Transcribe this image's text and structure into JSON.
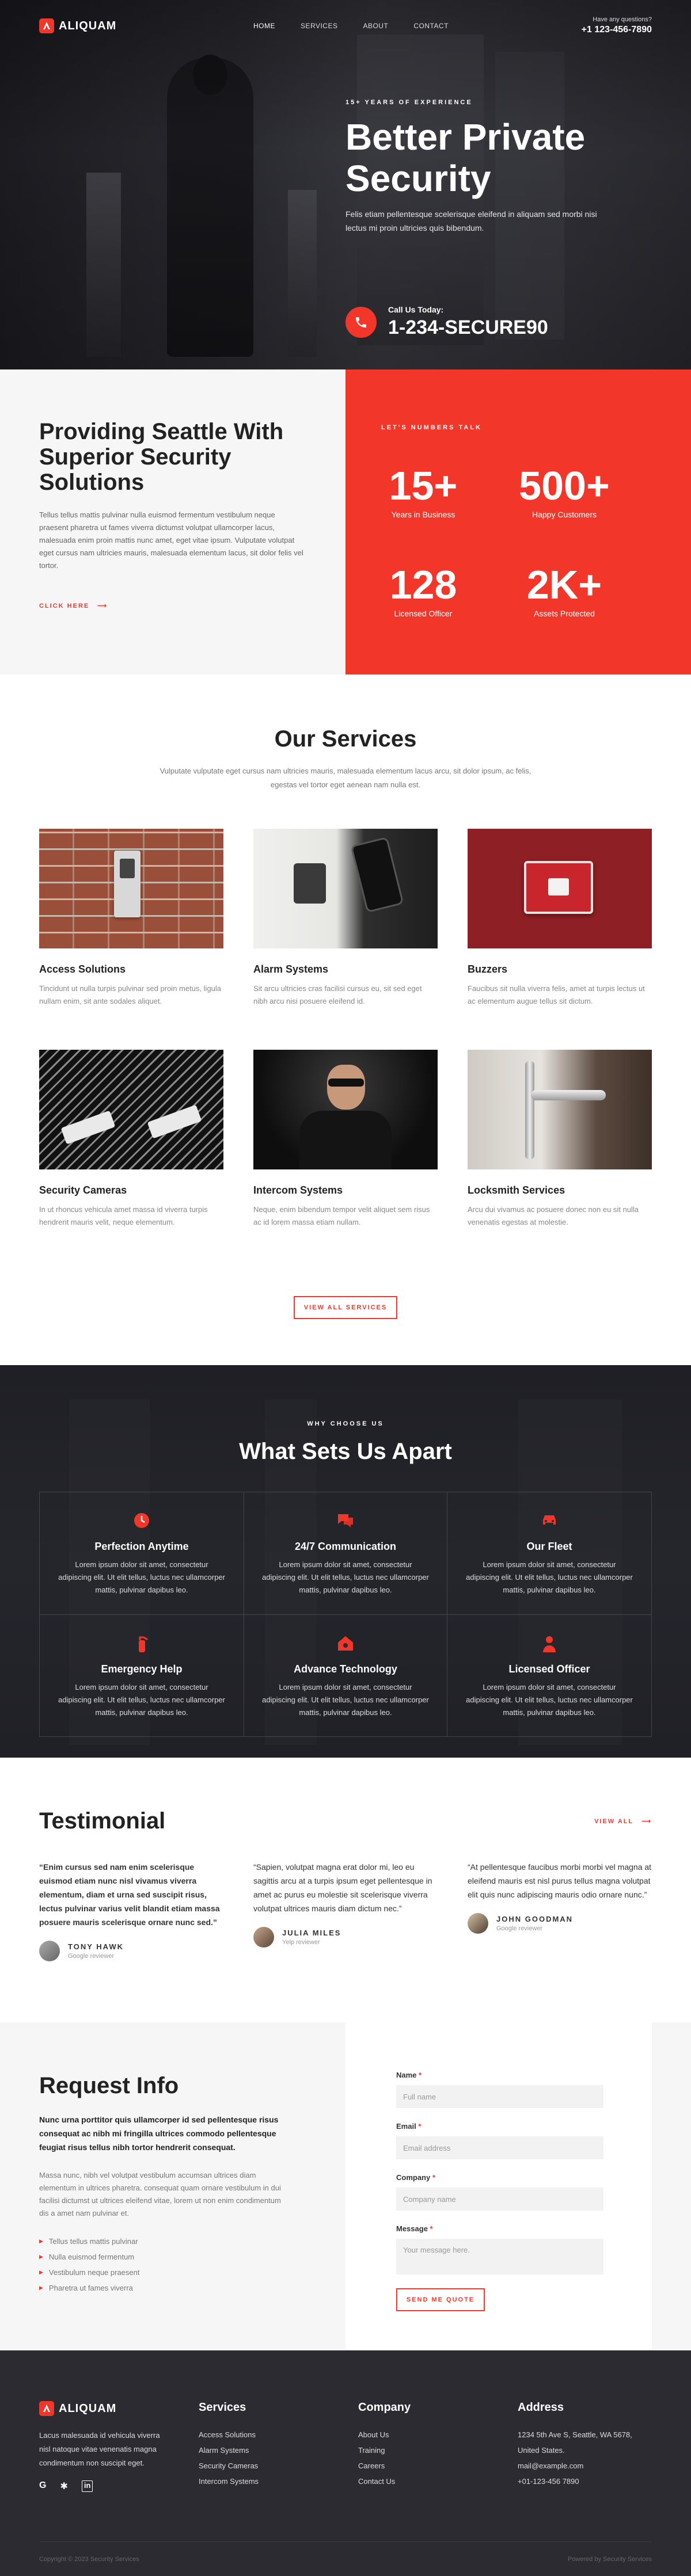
{
  "brand": {
    "name": "ALIQUAM",
    "accent": "#f2372a"
  },
  "nav": {
    "items": [
      "HOME",
      "SERVICES",
      "ABOUT",
      "CONTACT"
    ]
  },
  "top_contact": {
    "question": "Have any questions?",
    "phone": "+1 123-456-7890"
  },
  "hero": {
    "eyebrow": "15+ YEARS OF EXPERIENCE",
    "title_line1": "Better Private",
    "title_line2": "Security",
    "subtitle": "Felis etiam pellentesque scelerisque eleifend in aliquam sed morbi nisi lectus mi proin ultricies quis bibendum.",
    "call_label": "Call Us Today:",
    "call_number": "1-234-SECURE90"
  },
  "about": {
    "title": "Providing Seattle With Superior Security Solutions",
    "text": "Tellus tellus mattis pulvinar nulla euismod fermentum vestibulum neque praesent pharetra ut fames viverra dictumst volutpat ullamcorper lacus, malesuada enim proin mattis nunc amet, eget vitae ipsum. Vulputate volutpat eget cursus nam ultricies mauris, malesuada elementum lacus, sit dolor felis vel tortor.",
    "link": "CLICK HERE"
  },
  "stats": {
    "eyebrow": "LET'S NUMBERS TALK",
    "items": [
      {
        "num": "15+",
        "label": "Years in Business"
      },
      {
        "num": "500+",
        "label": "Happy Customers"
      },
      {
        "num": "128",
        "label": "Licensed Officer"
      },
      {
        "num": "2K+",
        "label": "Assets Protected"
      }
    ]
  },
  "services": {
    "title": "Our Services",
    "subtitle": "Vulputate vulputate eget cursus nam ultricies mauris, malesuada elementum lacus arcu, sit dolor ipsum, ac felis, egestas vel tortor eget aenean nam nulla est.",
    "items": [
      {
        "name": "Access Solutions",
        "desc": "Tincidunt ut nulla turpis pulvinar sed proin metus, ligula nullam enim, sit ante sodales aliquet."
      },
      {
        "name": "Alarm Systems",
        "desc": "Sit arcu ultricies cras facilisi cursus eu, sit sed eget nibh arcu nisi posuere eleifend id."
      },
      {
        "name": "Buzzers",
        "desc": "Faucibus sit nulla viverra felis, amet at turpis lectus ut ac elementum augue tellus sit dictum."
      },
      {
        "name": "Security Cameras",
        "desc": "In ut rhoncus vehicula amet massa id viverra turpis hendrerit mauris velit, neque elementum."
      },
      {
        "name": "Intercom Systems",
        "desc": "Neque, enim bibendum tempor velit aliquet sem risus ac id lorem massa etiam nullam."
      },
      {
        "name": "Locksmith Services",
        "desc": "Arcu dui vivamus ac posuere donec non eu sit nulla venenatis egestas at molestie."
      }
    ],
    "button": "VIEW ALL SERVICES"
  },
  "why": {
    "eyebrow": "WHY CHOOSE US",
    "title": "What Sets Us Apart",
    "items": [
      {
        "icon": "clock-icon",
        "title": "Perfection Anytime",
        "desc": "Lorem ipsum dolor sit amet, consectetur adipiscing elit. Ut elit tellus, luctus nec ullamcorper mattis, pulvinar dapibus leo."
      },
      {
        "icon": "chat-icon",
        "title": "24/7 Communication",
        "desc": "Lorem ipsum dolor sit amet, consectetur adipiscing elit. Ut elit tellus, luctus nec ullamcorper mattis, pulvinar dapibus leo."
      },
      {
        "icon": "car-icon",
        "title": "Our Fleet",
        "desc": "Lorem ipsum dolor sit amet, consectetur adipiscing elit. Ut elit tellus, luctus nec ullamcorper mattis, pulvinar dapibus leo."
      },
      {
        "icon": "fire-extinguisher-icon",
        "title": "Emergency Help",
        "desc": "Lorem ipsum dolor sit amet, consectetur adipiscing elit. Ut elit tellus, luctus nec ullamcorper mattis, pulvinar dapibus leo."
      },
      {
        "icon": "house-gear-icon",
        "title": "Advance Technology",
        "desc": "Lorem ipsum dolor sit amet, consectetur adipiscing elit. Ut elit tellus, luctus nec ullamcorper mattis, pulvinar dapibus leo."
      },
      {
        "icon": "officer-icon",
        "title": "Licensed Officer",
        "desc": "Lorem ipsum dolor sit amet, consectetur adipiscing elit. Ut elit tellus, luctus nec ullamcorper mattis, pulvinar dapibus leo."
      }
    ]
  },
  "testimonials": {
    "title": "Testimonial",
    "view_all": "VIEW ALL",
    "items": [
      {
        "quote": "“Enim cursus sed nam enim scelerisque euismod etiam nunc nisl vivamus viverra elementum, diam et urna sed suscipit risus, lectus pulvinar varius velit blandit etiam massa posuere mauris scelerisque ornare nunc sed.”",
        "name": "TONY HAWK",
        "role": "Google reviewer"
      },
      {
        "quote": "“Sapien, volutpat magna erat dolor mi, leo eu sagittis arcu at a turpis ipsum eget pellentesque in amet ac purus eu molestie sit scelerisque viverra volutpat ultrices mauris diam dictum nec.”",
        "name": "JULIA MILES",
        "role": "Yelp reviewer"
      },
      {
        "quote": "“At pellentesque faucibus morbi morbi vel magna at eleifend mauris est nisl purus tellus magna volutpat elit quis nunc adipiscing mauris odio ornare nunc.”",
        "name": "JOHN GOODMAN",
        "role": "Google reviewer"
      }
    ]
  },
  "request": {
    "title": "Request Info",
    "lead": "Nunc urna porttitor quis ullamcorper id sed pellentesque risus consequat ac nibh mi fringilla ultrices commodo pellentesque feugiat risus tellus nibh tortor hendrerit consequat.",
    "text": "Massa nunc, nibh vel volutpat vestibulum accumsan ultrices diam elementum in ultrices pharetra. consequat quam ornare vestibulum in dui facilisi dictumst ut ultrices eleifend vitae, lorem ut non enim condimentum dis a amet nam pulvinar et.",
    "bullets": [
      "Tellus tellus mattis pulvinar",
      "Nulla euismod fermentum",
      "Vestibulum neque praesent",
      "Pharetra ut fames viverra"
    ]
  },
  "form": {
    "name_label": "Name",
    "name_placeholder": "Full name",
    "email_label": "Email",
    "email_placeholder": "Email address",
    "company_label": "Company",
    "company_placeholder": "Company name",
    "message_label": "Message",
    "message_placeholder": "Your message here.",
    "submit": "SEND ME QUOTE"
  },
  "footer": {
    "about": "Lacus malesuada id vehicula viverra nisl natoque vitae venenatis magna condimentum non suscipit eget.",
    "services_head": "Services",
    "services": [
      "Access Solutions",
      "Alarm Systems",
      "Security Cameras",
      "Intercom Systems"
    ],
    "company_head": "Company",
    "company": [
      "About Us",
      "Training",
      "Careers",
      "Contact Us"
    ],
    "address_head": "Address",
    "address": [
      "1234 5th Ave S, Seattle, WA 5678,",
      "United States.",
      "mail@example.com",
      "+01-123-456 7890"
    ],
    "copyright": "Copyright © 2023 Security Services",
    "powered": "Powered by Security Services"
  }
}
